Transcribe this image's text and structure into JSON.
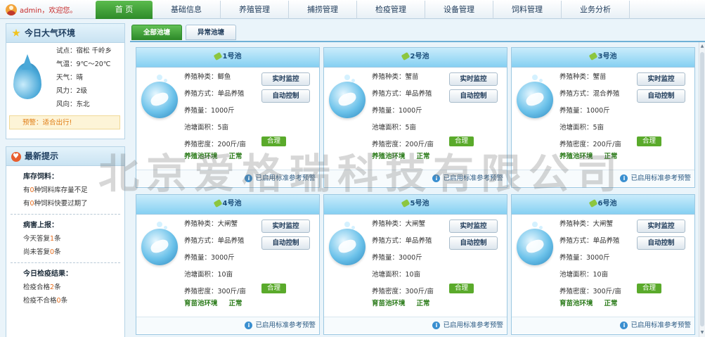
{
  "header": {
    "user_label": "admin，欢迎您。",
    "nav": [
      "首 页",
      "基础信息",
      "养殖管理",
      "捕捞管理",
      "检疫管理",
      "设备管理",
      "饲料管理",
      "业务分析"
    ]
  },
  "weather": {
    "title": "今日大气环境",
    "lines": [
      "试点：宿松 千岭乡",
      "气温：9℃～20℃",
      "天气：晴",
      "风力：2级",
      "风向：东北"
    ],
    "warning": "预警：适合出行!"
  },
  "tips": {
    "title": "最新提示",
    "feed": {
      "title": "库存饲料：",
      "line1_a": "有",
      "line1_n": "0",
      "line1_b": "种饲料库存量不足",
      "line2_a": "有",
      "line2_n": "0",
      "line2_b": "种饲料快要过期了"
    },
    "disease": {
      "title": "病害上报：",
      "line1_a": "今天答复",
      "line1_n": "1",
      "line1_b": "条",
      "line2_a": "尚未答复",
      "line2_n": "0",
      "line2_b": "条"
    },
    "quarantine": {
      "title": "今日检疫结果：",
      "line1_a": "检疫合格",
      "line1_n": "2",
      "line1_b": "条",
      "line2_a": "检疫不合格",
      "line2_n": "0",
      "line2_b": "条"
    }
  },
  "tabs": [
    "全部池塘",
    "异常池塘"
  ],
  "ponds": [
    {
      "name": "1号池",
      "species": "养殖种类：鲫鱼",
      "method": "养殖方式：单品养殖",
      "amount": "养殖量：1000斤",
      "area": "池塘面积：5亩",
      "density": "养殖密度：200斤/亩",
      "badge": "合理",
      "env": "养殖池环境",
      "state": "正常",
      "btn1": "实时监控",
      "btn2": "自动控制",
      "footer": "已启用标准参考预警"
    },
    {
      "name": "2号池",
      "species": "养殖种类：蟹苗",
      "method": "养殖方式：单品养殖",
      "amount": "养殖量：1000斤",
      "area": "池塘面积：5亩",
      "density": "养殖密度：200斤/亩",
      "badge": "合理",
      "env": "养殖池环境",
      "state": "正常",
      "btn1": "实时监控",
      "btn2": "自动控制",
      "footer": "已启用标准参考预警"
    },
    {
      "name": "3号池",
      "species": "养殖种类：蟹苗",
      "method": "养殖方式：混合养殖",
      "amount": "养殖量：1000斤",
      "area": "池塘面积：5亩",
      "density": "养殖密度：200斤/亩",
      "badge": "合理",
      "env": "养殖池环境",
      "state": "正常",
      "btn1": "实时监控",
      "btn2": "自动控制",
      "footer": "已启用标准参考预警"
    },
    {
      "name": "4号池",
      "species": "养殖种类：大闸蟹",
      "method": "养殖方式：单品养殖",
      "amount": "养殖量：3000斤",
      "area": "池塘面积：10亩",
      "density": "养殖密度：300斤/亩",
      "badge": "合理",
      "env": "育苗池环境",
      "state": "正常",
      "btn1": "实时监控",
      "btn2": "自动控制",
      "footer": "已启用标准参考预警"
    },
    {
      "name": "5号池",
      "species": "养殖种类：大闸蟹",
      "method": "养殖方式：单品养殖",
      "amount": "养殖量：3000斤",
      "area": "池塘面积：10亩",
      "density": "养殖密度：300斤/亩",
      "badge": "合理",
      "env": "育苗池环境",
      "state": "正常",
      "btn1": "实时监控",
      "btn2": "自动控制",
      "footer": "已启用标准参考预警"
    },
    {
      "name": "6号池",
      "species": "养殖种类：大闸蟹",
      "method": "养殖方式：单品养殖",
      "amount": "养殖量：3000斤",
      "area": "池塘面积：10亩",
      "density": "养殖密度：300斤/亩",
      "badge": "合理",
      "env": "育苗池环境",
      "state": "正常",
      "btn1": "实时监控",
      "btn2": "自动控制",
      "footer": "已启用标准参考预警"
    }
  ],
  "watermark": "北京爱格瑞科技有限公司"
}
